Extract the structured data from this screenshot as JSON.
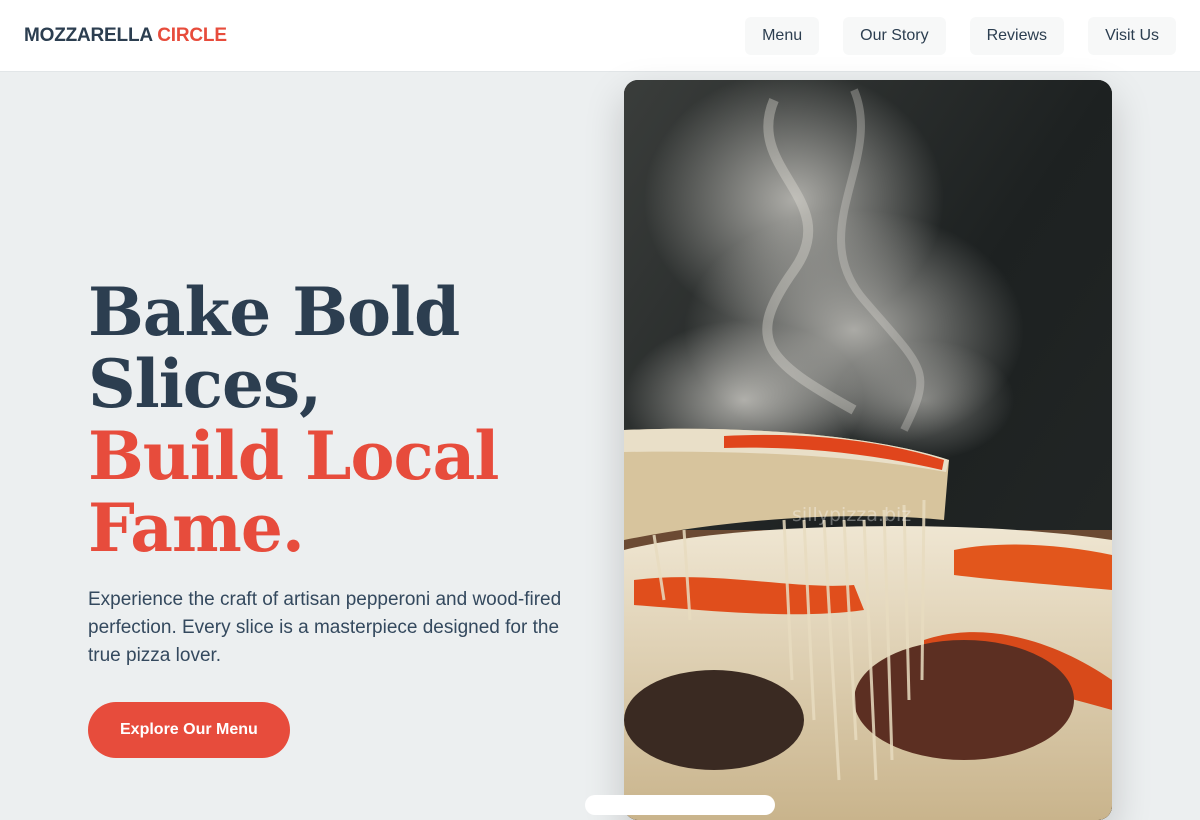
{
  "brand": {
    "name": "MOZZARELLA",
    "accent": "CIRCLE"
  },
  "nav": {
    "items": [
      "Menu",
      "Our Story",
      "Reviews",
      "Visit Us"
    ]
  },
  "hero": {
    "headline_line1": "Bake Bold",
    "headline_line2": "Slices,",
    "headline_line3": "Build Local",
    "headline_line4": "Fame.",
    "subtext": "Experience the craft of artisan pepperoni and wood-fired perfection. Every slice is a masterpiece designed for the true pizza lover.",
    "cta_label": "Explore Our Menu"
  },
  "photo": {
    "watermark": "sillypizza.biz"
  },
  "colors": {
    "primary": "#2c3e50",
    "accent": "#e74c3c",
    "background": "#eceff0"
  }
}
